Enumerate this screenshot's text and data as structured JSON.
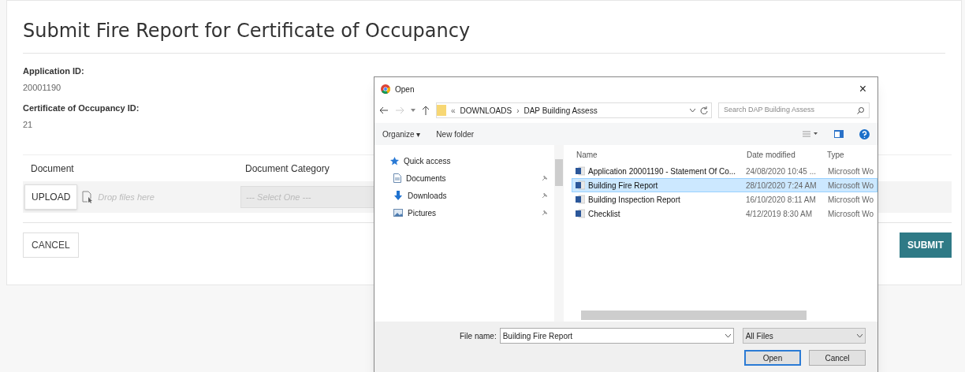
{
  "page": {
    "title": "Submit Fire Report for Certificate of Occupancy",
    "fields": [
      {
        "label": "Application ID:",
        "value": "20001190"
      },
      {
        "label": "Certificate of Occupancy ID:",
        "value": "21"
      }
    ],
    "table": {
      "columns": [
        "Document",
        "Document Category"
      ],
      "upload_button": "UPLOAD",
      "drop_hint": "Drop files here",
      "category_placeholder": "--- Select One ---"
    },
    "buttons": {
      "cancel": "CANCEL",
      "submit": "SUBMIT"
    }
  },
  "dialog": {
    "title": "Open",
    "close": "×",
    "address": {
      "crumbs": [
        "«",
        "DOWNLOADS",
        "›",
        "DAP Building Assess"
      ]
    },
    "search": {
      "placeholder": "Search DAP Building Assess"
    },
    "toolbar": [
      "Organize ▾",
      "New folder"
    ],
    "nav": [
      {
        "label": "Quick access",
        "kind": "star",
        "pinned": false
      },
      {
        "label": "Documents",
        "kind": "documents",
        "pinned": true
      },
      {
        "label": "Downloads",
        "kind": "downloads",
        "pinned": true
      },
      {
        "label": "Pictures",
        "kind": "pictures",
        "pinned": true
      }
    ],
    "columns": [
      "Name",
      "Date modified",
      "Type"
    ],
    "files": [
      {
        "name": "Application 20001190 - Statement Of Co...",
        "date": "24/08/2020 10:45 ...",
        "type": "Microsoft Wo",
        "selected": false
      },
      {
        "name": "Building Fire Report",
        "date": "28/10/2020 7:24 AM",
        "type": "Microsoft Wo",
        "selected": true
      },
      {
        "name": "Building Inspection Report",
        "date": "16/10/2020 8:11 AM",
        "type": "Microsoft Wo",
        "selected": false
      },
      {
        "name": "Checklist",
        "date": "4/12/2019 8:30 AM",
        "type": "Microsoft Wo",
        "selected": false
      }
    ],
    "file_name": {
      "label": "File name:",
      "value": "Building Fire Report"
    },
    "file_type": "All Files",
    "buttons": {
      "open": "Open",
      "cancel": "Cancel"
    }
  }
}
